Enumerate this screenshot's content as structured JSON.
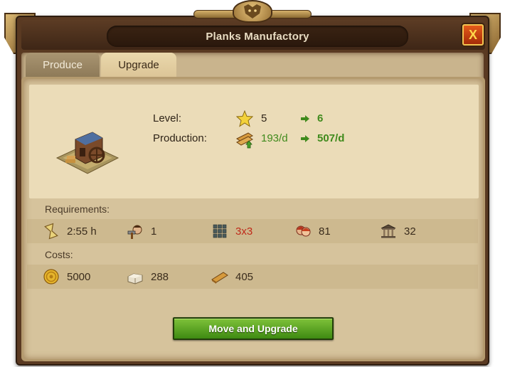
{
  "window": {
    "title": "Planks Manufactory",
    "close_label": "X"
  },
  "tabs": [
    {
      "label": "Produce",
      "active": false
    },
    {
      "label": "Upgrade",
      "active": true
    }
  ],
  "upgrade": {
    "level_label": "Level:",
    "level_current": "5",
    "level_next": "6",
    "production_label": "Production:",
    "production_current": "193/d",
    "production_next": "507/d"
  },
  "requirements": {
    "label": "Requirements:",
    "items": [
      {
        "icon": "hourglass-icon",
        "value": "2:55 h"
      },
      {
        "icon": "builder-icon",
        "value": "1"
      },
      {
        "icon": "grid-size-icon",
        "value": "3x3"
      },
      {
        "icon": "population-icon",
        "value": "81"
      },
      {
        "icon": "culture-icon",
        "value": "32"
      }
    ]
  },
  "costs": {
    "label": "Costs:",
    "items": [
      {
        "icon": "coin-icon",
        "value": "5000"
      },
      {
        "icon": "stone-icon",
        "value": "288"
      },
      {
        "icon": "planks-icon",
        "value": "405"
      }
    ]
  },
  "action": {
    "label": "Move and Upgrade"
  },
  "colors": {
    "accent_green": "#3f8a1c",
    "warning_red": "#c02a1a",
    "frame_brown": "#5a3a22",
    "parchment": "#ebdcb8"
  }
}
